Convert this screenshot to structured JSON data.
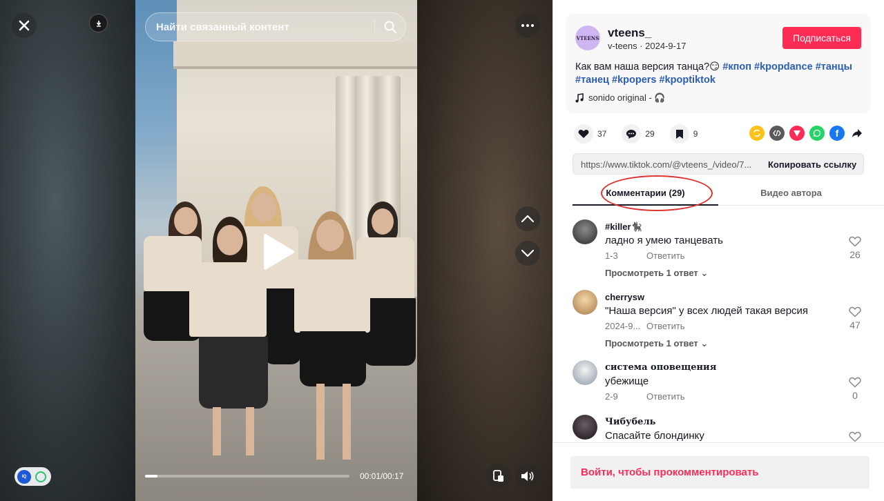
{
  "video": {
    "search_placeholder": "Найти связанный контент",
    "timecode": "00:01/00:17",
    "progress": 0.06
  },
  "author": {
    "avatar_text": "VTEENS",
    "name": "vteens_",
    "meta": "v-teens · 2024-9-17",
    "subscribe_label": "Подписаться"
  },
  "description": {
    "text": "Как вам наша версия танца?😏",
    "tags": [
      "#кпоп",
      "#kpopdance",
      "#танцы",
      "#танец",
      "#kpopers",
      "#kpoptiktok"
    ]
  },
  "music": "sonido original - 🎧",
  "actions": {
    "likes": "37",
    "comments": "29",
    "saves": "9"
  },
  "share_colors": {
    "repost": "#ffc21a",
    "embed": "#5a5a5a",
    "send": "#fe2c55",
    "whatsapp": "#25d366",
    "facebook": "#1877f2"
  },
  "link": {
    "url": "https://www.tiktok.com/@vteens_/video/7...",
    "copy_label": "Копировать ссылку"
  },
  "tabs": {
    "comments": "Комментарии (29)",
    "author_videos": "Видео автора"
  },
  "comments": [
    {
      "user": "#killer🐈‍⬛",
      "text": "ладно я умею танцевать",
      "date": "1-3",
      "reply": "Ответить",
      "more": "Просмотреть 1 ответ",
      "likes": "26"
    },
    {
      "user": "cherrysw",
      "text": "\"Наша версия\" у всех людей такая версия",
      "date": "2024-9...",
      "reply": "Ответить",
      "more": "Просмотреть 1 ответ",
      "likes": "47"
    },
    {
      "user": "система оповещения",
      "text": "убежище",
      "date": "2-9",
      "reply": "Ответить",
      "more": "",
      "likes": "0"
    },
    {
      "user": "Чибубель",
      "text": "Спасайте блондинку",
      "date": "",
      "reply": "",
      "more": "",
      "likes": ""
    }
  ],
  "footer": {
    "login_label": "Войти, чтобы прокомментировать"
  },
  "colors": {
    "accent": "#fe2c55",
    "hashtag": "#2b5db3"
  }
}
